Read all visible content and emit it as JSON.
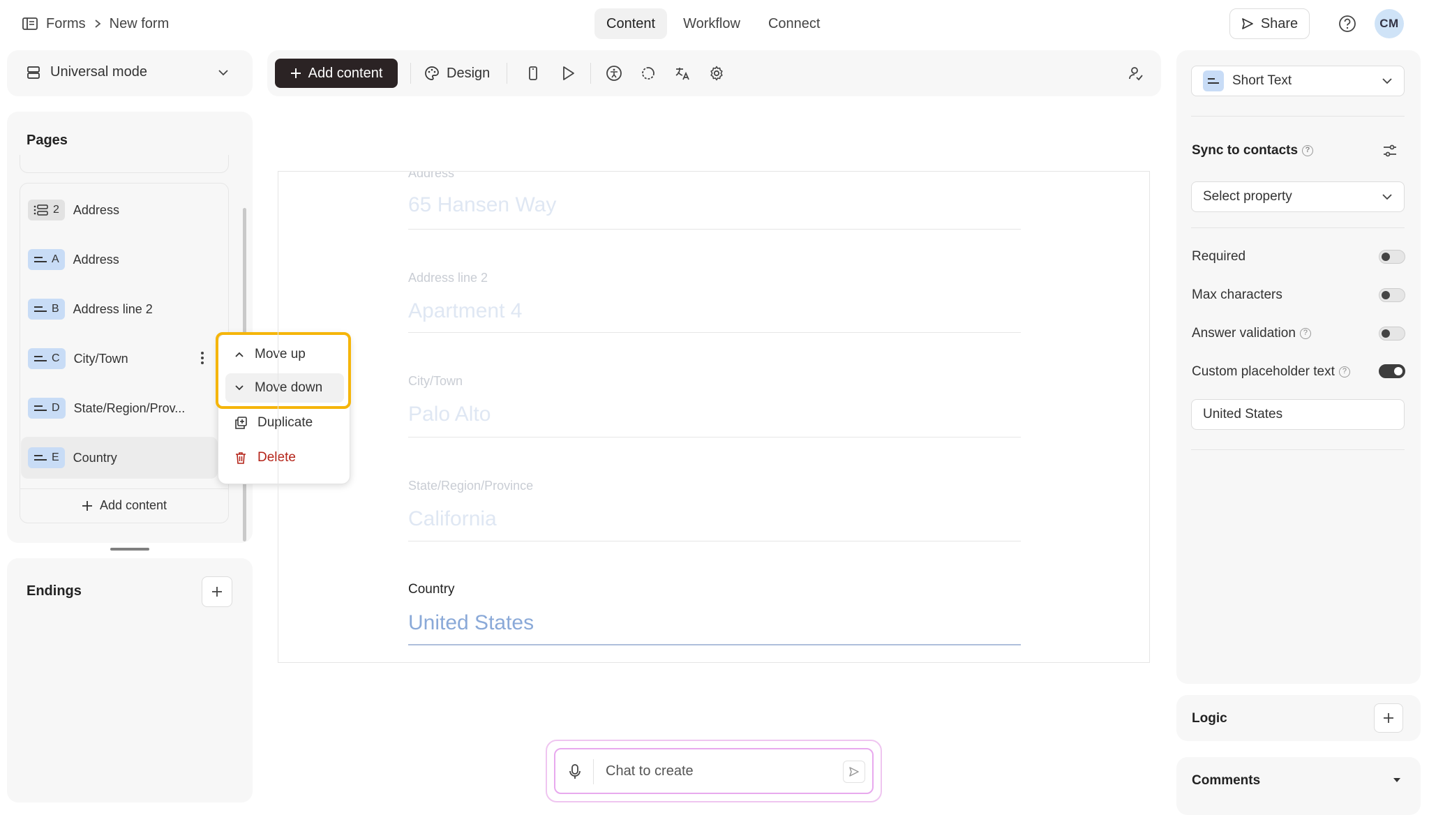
{
  "breadcrumb": {
    "root": "Forms",
    "current": "New form"
  },
  "tabs": [
    {
      "label": "Content"
    },
    {
      "label": "Workflow"
    },
    {
      "label": "Connect"
    }
  ],
  "header": {
    "share_label": "Share",
    "avatar_initials": "CM"
  },
  "mode": {
    "label": "Universal mode"
  },
  "toolbar": {
    "add_content_label": "Add content",
    "design_label": "Design"
  },
  "pages": {
    "title": "Pages",
    "items": [
      {
        "badge_letter": "2",
        "label": "Address"
      },
      {
        "badge_letter": "A",
        "label": "Address"
      },
      {
        "badge_letter": "B",
        "label": "Address line 2"
      },
      {
        "badge_letter": "C",
        "label": "City/Town"
      },
      {
        "badge_letter": "D",
        "label": "State/Region/Prov..."
      },
      {
        "badge_letter": "E",
        "label": "Country"
      }
    ],
    "add_content_label": "Add content"
  },
  "endings": {
    "title": "Endings"
  },
  "context_menu": {
    "move_up": "Move up",
    "move_down": "Move down",
    "duplicate": "Duplicate",
    "delete": "Delete"
  },
  "form": {
    "fields": [
      {
        "label": "Address",
        "value": "65 Hansen Way"
      },
      {
        "label": "Address line 2",
        "value": "Apartment 4"
      },
      {
        "label": "City/Town",
        "value": "Palo Alto"
      },
      {
        "label": "State/Region/Province",
        "value": "California"
      },
      {
        "label": "Country",
        "value": "United States"
      }
    ]
  },
  "chat": {
    "placeholder": "Chat to create"
  },
  "settings": {
    "field_type": "Short Text",
    "sync_title": "Sync to contacts",
    "select_property": "Select property",
    "required_label": "Required",
    "required_on": false,
    "max_characters_label": "Max characters",
    "max_characters_on": false,
    "answer_validation_label": "Answer validation",
    "answer_validation_on": false,
    "custom_placeholder_label": "Custom placeholder text",
    "custom_placeholder_on": true,
    "placeholder_value": "United States"
  },
  "logic": {
    "title": "Logic"
  },
  "comments": {
    "title": "Comments"
  },
  "colors": {
    "accent": "#2b2324",
    "highlight": "#f5b50a",
    "badge_blue": "#c8dcf6",
    "danger": "#b42318"
  }
}
